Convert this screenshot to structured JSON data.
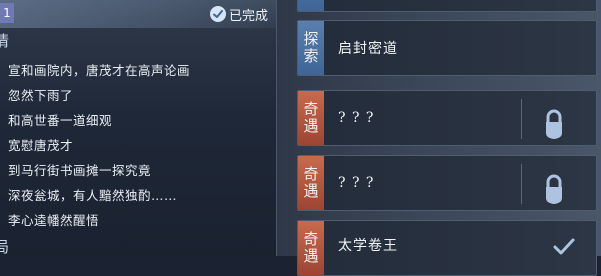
{
  "left": {
    "tag": "1",
    "status": "已完成",
    "section_mark": "情",
    "section_mark_bottom": "局",
    "story_lines": [
      "宣和画院内，唐茂才在高声论画",
      "忽然下雨了",
      "和高世番一道细观",
      "宽慰唐茂才",
      "到马行街书画摊一探究竟",
      "深夜瓮城，有人黯然独酌……",
      "李心逵幡然醒悟"
    ]
  },
  "quests": [
    {
      "tab_chars": [
        "探",
        "索"
      ],
      "tab_type": "explore",
      "title": "启封密道",
      "state": "none"
    },
    {
      "tab_chars": [
        "奇",
        "遇"
      ],
      "tab_type": "encounter",
      "title": "? ? ?",
      "state": "locked"
    },
    {
      "tab_chars": [
        "奇",
        "遇"
      ],
      "tab_type": "encounter",
      "title": "? ? ?",
      "state": "locked"
    },
    {
      "tab_chars": [
        "奇",
        "遇"
      ],
      "tab_type": "encounter",
      "title": "太学卷王",
      "state": "completed"
    }
  ],
  "colors": {
    "explore_tab": "#4a72a3",
    "encounter_tab": "#b1543d",
    "icon": "#aec3df"
  }
}
